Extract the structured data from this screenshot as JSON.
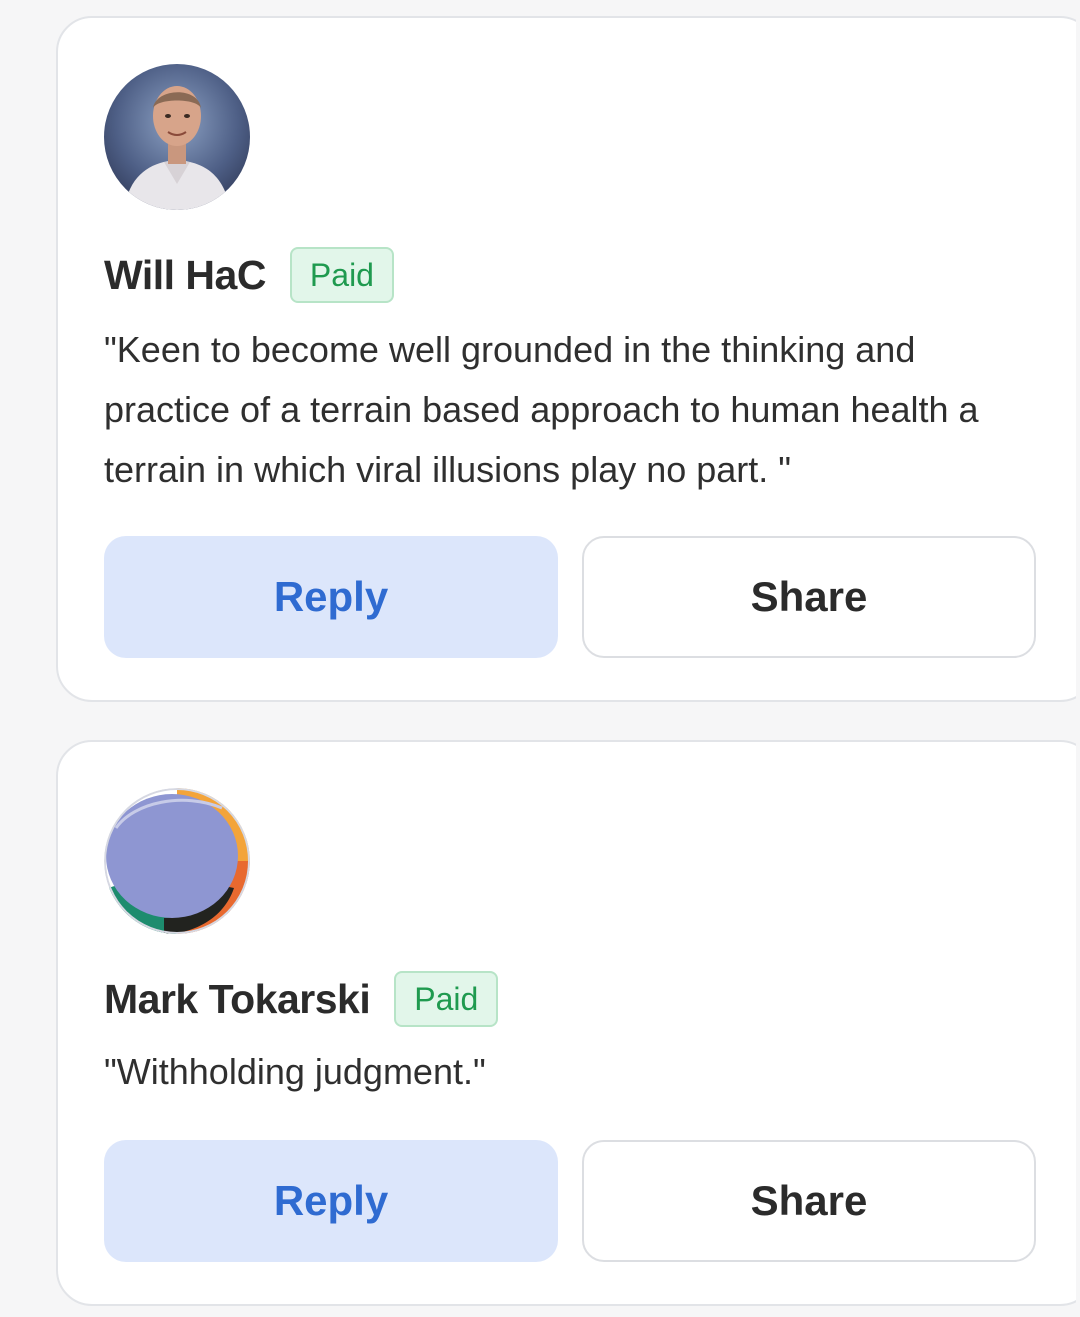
{
  "comments": [
    {
      "author": "Will HaC",
      "badge": "Paid",
      "text": "\"Keen to become well grounded in the thinking and practice of a terrain based approach to human health a terrain in which viral illusions play no part. \"",
      "avatar_icon": "profile-photo",
      "reply_label": "Reply",
      "share_label": "Share"
    },
    {
      "author": "Mark Tokarski",
      "badge": "Paid",
      "text": "\"Withholding judgment.\"",
      "avatar_icon": "abstract-circle-avatar",
      "reply_label": "Reply",
      "share_label": "Share"
    }
  ],
  "colors": {
    "reply_bg": "#dce6fb",
    "reply_text": "#2f6bd1",
    "badge_bg": "#e2f6ea",
    "badge_text": "#1f9a4f",
    "card_border": "#e2e4e8"
  }
}
